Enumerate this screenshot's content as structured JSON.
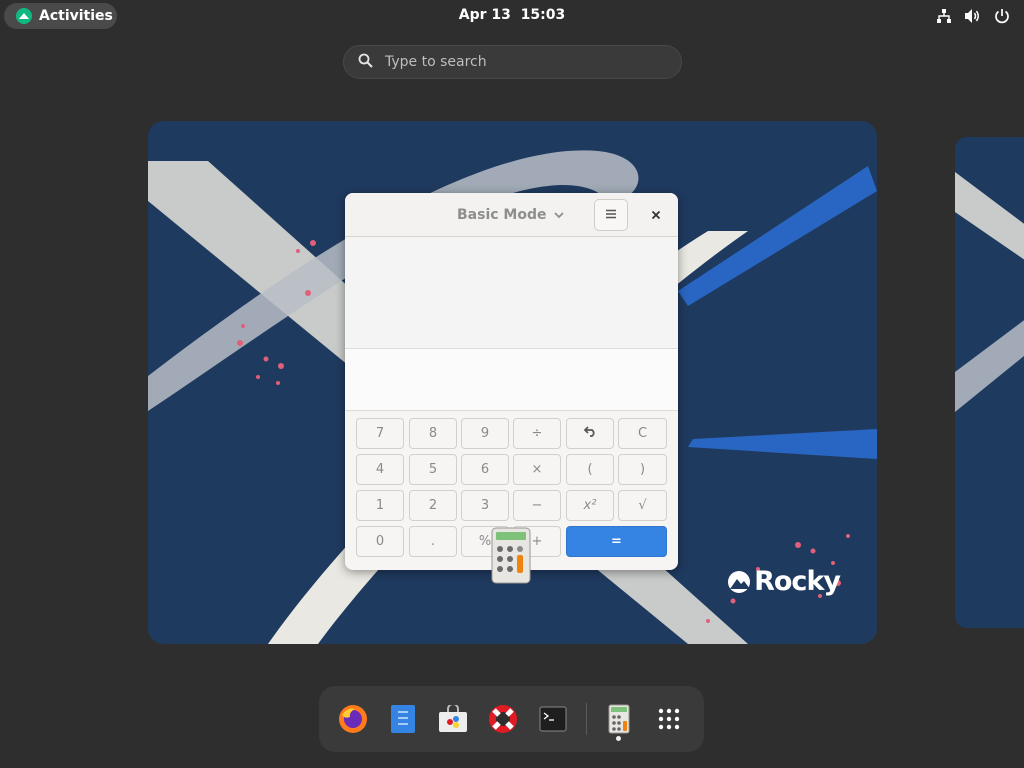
{
  "topbar": {
    "activities_label": "Activities",
    "clock": "Apr 13  15:03",
    "icons": [
      "network-icon",
      "volume-icon",
      "power-icon"
    ]
  },
  "search": {
    "placeholder": "Type to search"
  },
  "calculator": {
    "mode_label": "Basic Mode",
    "keys": [
      [
        "7",
        "8",
        "9",
        "÷",
        "⮌",
        "C"
      ],
      [
        "4",
        "5",
        "6",
        "×",
        "(",
        ")"
      ],
      [
        "1",
        "2",
        "3",
        "−",
        "x²",
        "√"
      ],
      [
        "0",
        ".",
        "%",
        "+",
        "="
      ]
    ]
  },
  "wallpaper": {
    "brand": "Rocky"
  },
  "dash": {
    "apps": [
      "firefox-icon",
      "notes-icon",
      "software-icon",
      "help-icon",
      "terminal-icon",
      "calculator-icon",
      "app-grid-icon"
    ]
  },
  "colors": {
    "accent": "#3584e4",
    "topbar_bg": "#2e2e2e",
    "wallpaper_bg": "#1f3a5f",
    "dash_bg": "#3a3a3a"
  }
}
